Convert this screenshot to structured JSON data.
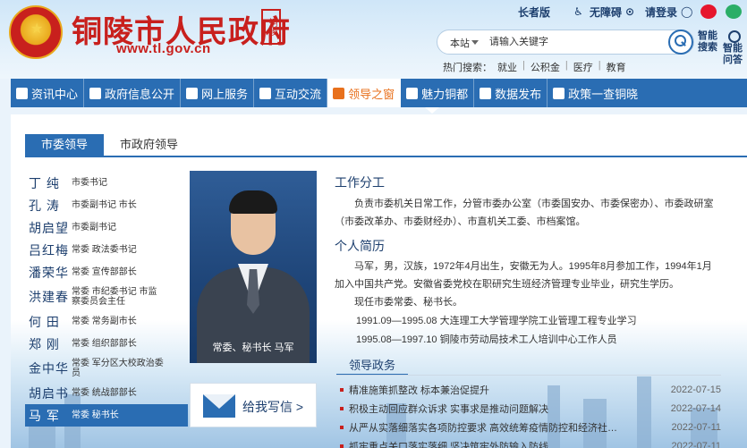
{
  "header": {
    "site_title": "铜陵市人民政府",
    "seal_text": "铜陵",
    "site_url": "www.tl.gov.cn",
    "links": {
      "elder": "长者版",
      "accessible": "无障碍",
      "login": "请登录"
    },
    "search": {
      "scope": "本站",
      "placeholder": "请输入关键字"
    },
    "smart_search": "智能搜索",
    "smart_qa": "智能问答",
    "hot_search_label": "热门搜索：",
    "hot_search": [
      "就业",
      "公积金",
      "医疗",
      "教育"
    ]
  },
  "nav": [
    {
      "label": "资讯中心",
      "icon": "book-icon"
    },
    {
      "label": "政府信息公开",
      "icon": "document-icon"
    },
    {
      "label": "网上服务",
      "icon": "people-icon"
    },
    {
      "label": "互动交流",
      "icon": "chat-icon"
    },
    {
      "label": "领导之窗",
      "icon": "leader-icon",
      "active": true
    },
    {
      "label": "魅力铜都",
      "icon": "book-open-icon"
    },
    {
      "label": "数据发布",
      "icon": "chart-icon"
    },
    {
      "label": "政策一查铜晓",
      "icon": "search-doc-icon"
    }
  ],
  "tabs": [
    {
      "label": "市委领导",
      "active": true
    },
    {
      "label": "市政府领导",
      "active": false
    }
  ],
  "leaders": [
    {
      "name": "丁 纯",
      "title": "市委书记"
    },
    {
      "name": "孔 涛",
      "title": "市委副书记 市长"
    },
    {
      "name": "胡启望",
      "title": "市委副书记"
    },
    {
      "name": "吕红梅",
      "title": "常委 政法委书记"
    },
    {
      "name": "潘荣华",
      "title": "常委 宣传部部长"
    },
    {
      "name": "洪建春",
      "title": "常委 市纪委书记 市监察委员会主任"
    },
    {
      "name": "何 田",
      "title": "常委 常务副市长"
    },
    {
      "name": "郑 刚",
      "title": "常委 组织部部长"
    },
    {
      "name": "金中华",
      "title": "常委 军分区大校政治委员"
    },
    {
      "name": "胡启书",
      "title": "常委 统战部部长"
    },
    {
      "name": "马 军",
      "title": "常委 秘书长",
      "active": true
    }
  ],
  "profile": {
    "caption": "常委、秘书长 马军",
    "write_letter": "给我写信 >",
    "work_heading": "工作分工",
    "work_text": "负责市委机关日常工作，分管市委办公室（市委国安办、市委保密办）、市委政研室（市委改革办、市委财经办）、市直机关工委、市档案馆。",
    "bio_heading": "个人简历",
    "bio_text": "马军，男，汉族，1972年4月出生，安徽无为人。1995年8月参加工作，1994年1月加入中国共产党。安徽省委党校在职研究生班经济管理专业毕业，研究生学历。",
    "current_post": "现任市委常委、秘书长。",
    "resume": [
      "1991.09—1995.08 大连理工大学管理学院工业管理工程专业学习",
      "1995.08—1997.10 铜陵市劳动局技术工人培训中心工作人员"
    ]
  },
  "affairs": {
    "heading": "领导政务",
    "items": [
      {
        "title": "精准施策抓整改 标本兼治促提升",
        "date": "2022-07-15"
      },
      {
        "title": "积极主动回应群众诉求 实事求是推动问题解决",
        "date": "2022-07-14"
      },
      {
        "title": "从严从实落细落实各项防控要求 高效统筹疫情防控和经济社…",
        "date": "2022-07-11"
      },
      {
        "title": "抓牢重点关口落实落细 坚决筑牢外防输入防线",
        "date": "2022-07-11"
      }
    ]
  }
}
